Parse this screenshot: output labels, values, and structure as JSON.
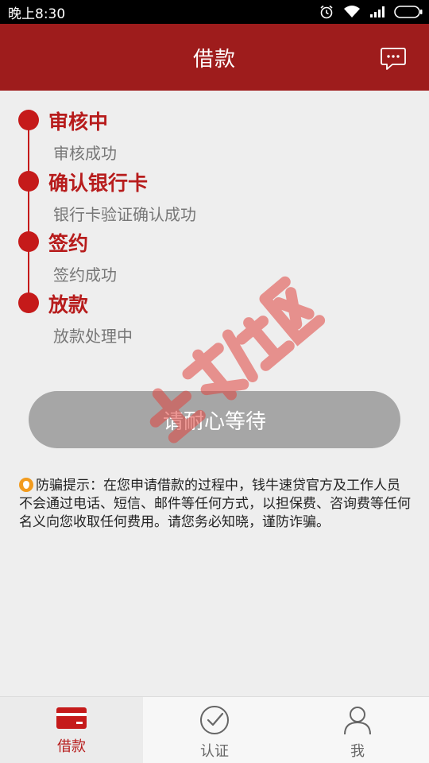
{
  "status_bar": {
    "time": "晚上8:30"
  },
  "header": {
    "title": "借款"
  },
  "steps": [
    {
      "title": "审核中",
      "desc": "审核成功"
    },
    {
      "title": "确认银行卡",
      "desc": "银行卡验证确认成功"
    },
    {
      "title": "签约",
      "desc": "签约成功"
    },
    {
      "title": "放款",
      "desc": "放款处理中"
    }
  ],
  "wait_button": {
    "label": "请耐心等待"
  },
  "tip": {
    "text": "防骗提示：在您申请借款的过程中，钱牛速贷官方及工作人员不会通过电话、短信、邮件等任何方式，以担保费、咨询费等任何名义向您收取任何费用。请您务必知晓，谨防诈骗。"
  },
  "tabs": [
    {
      "label": "借款",
      "icon": "card-icon",
      "active": true
    },
    {
      "label": "认证",
      "icon": "check-circle-icon",
      "active": false
    },
    {
      "label": "我",
      "icon": "user-icon",
      "active": false
    }
  ],
  "colors": {
    "brand": "#9e1c1c",
    "accent": "#c51a1a",
    "tip_icon": "#f29b1e",
    "button_disabled": "#a6a6a6"
  }
}
